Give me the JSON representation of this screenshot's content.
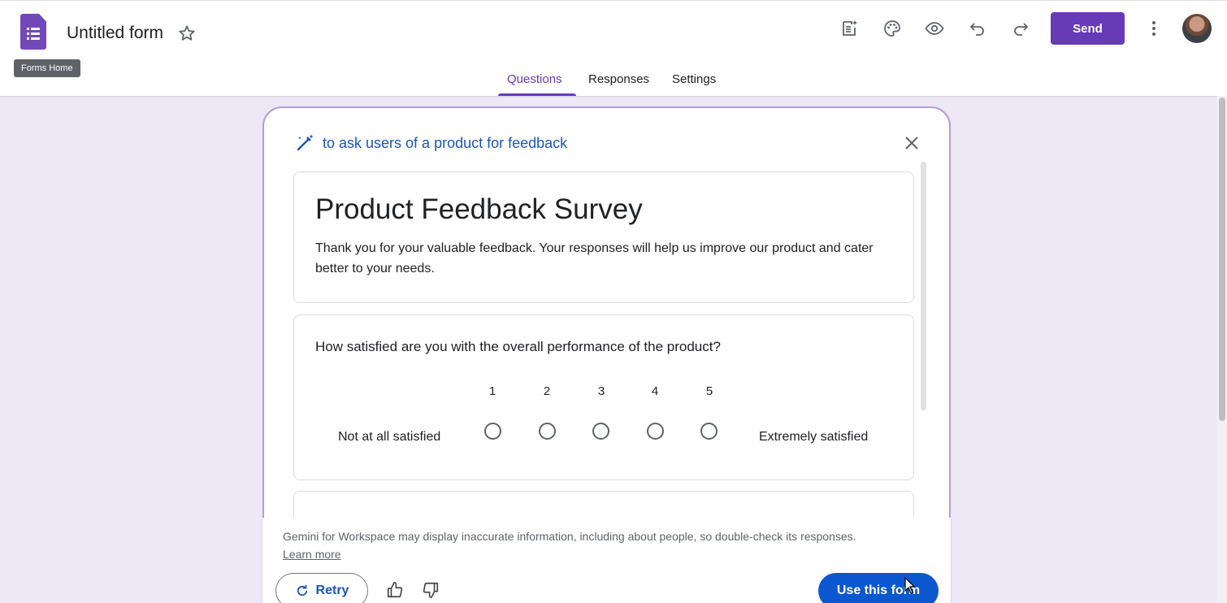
{
  "header": {
    "form_title": "Untitled form",
    "tooltip": "Forms Home",
    "send_label": "Send",
    "icons": [
      "customize-theme-ai-icon",
      "palette-icon",
      "eye-icon",
      "undo-icon",
      "redo-icon",
      "more-vert-icon"
    ]
  },
  "tabs": [
    {
      "label": "Questions",
      "active": true
    },
    {
      "label": "Responses",
      "active": false
    },
    {
      "label": "Settings",
      "active": false
    }
  ],
  "gemini": {
    "prompt": "to ask users of a product for feedback",
    "survey_title": "Product Feedback Survey",
    "survey_description": "Thank you for your valuable feedback. Your responses will help us improve our product and cater better to your needs.",
    "question": {
      "text": "How satisfied are you with the overall performance of the product?",
      "scale": [
        "1",
        "2",
        "3",
        "4",
        "5"
      ],
      "low_label": "Not at all satisfied",
      "high_label": "Extremely satisfied"
    },
    "disclaimer": "Gemini for Workspace may display inaccurate information, including about people, so double-check its responses.",
    "learn_more": "Learn more",
    "retry_label": "Retry",
    "use_label": "Use this form"
  },
  "colors": {
    "brand": "#673ab7",
    "background": "#ede7f6",
    "primary_button": "#0b57d0",
    "link": "#1a56b6"
  }
}
